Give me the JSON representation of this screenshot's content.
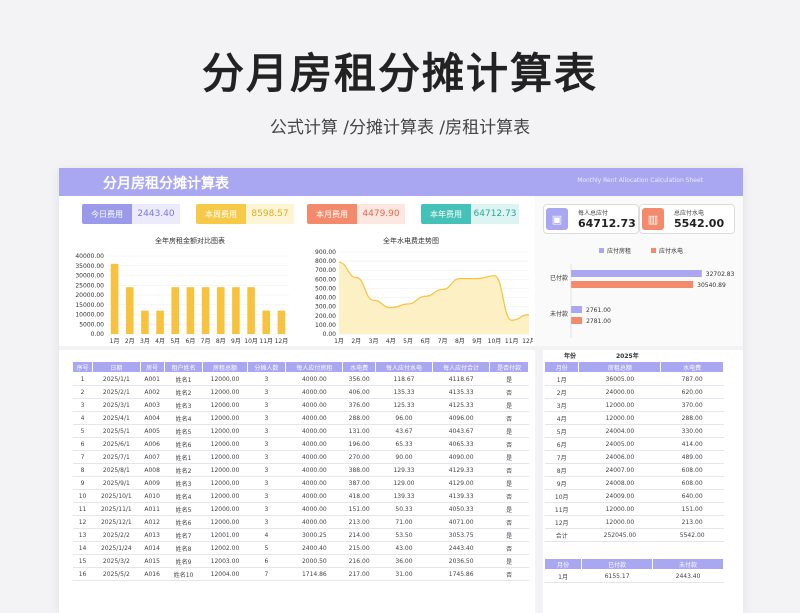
{
  "page": {
    "title": "分月房租分摊计算表",
    "subtitle": "公式计算 /分摊计算表 /房租计算表"
  },
  "sheet": {
    "banner_title": "分月房租分摊计算表",
    "banner_en": "Monthly Rent Allocation Calculation Sheet",
    "stats": [
      {
        "label": "今日费用",
        "value": "2443.40",
        "color": "#9b99ea",
        "bg": "#ecebfb",
        "fg": "#7b79d8"
      },
      {
        "label": "本周费用",
        "value": "8598.57",
        "color": "#f7c948",
        "bg": "#fdf5d6",
        "fg": "#e0ad1d"
      },
      {
        "label": "本月费用",
        "value": "4479.90",
        "color": "#f38a6c",
        "bg": "#fde8e1",
        "fg": "#e2694a"
      },
      {
        "label": "本年费用",
        "value": "64712.73",
        "color": "#45c2b8",
        "bg": "#dcf4f2",
        "fg": "#2fa69c"
      }
    ],
    "kpi": [
      {
        "title": "每人总应付",
        "value": "64712.73",
        "color": "#a9a6f2"
      },
      {
        "title": "总应付水电",
        "value": "5542.00",
        "color": "#f38a6c"
      }
    ],
    "legend": {
      "a": "应付房租",
      "b": "应付水电"
    },
    "hbar_categories": [
      "已付款",
      "未付款"
    ],
    "hbar_values": {
      "rent": [
        32702.83,
        2761.0
      ],
      "util": [
        30540.89,
        2781.0
      ]
    },
    "hbar_labels": {
      "rent": [
        "32702.83",
        "2761.00"
      ],
      "util": [
        "30540.89",
        "2781.00"
      ]
    }
  },
  "chart_data": [
    {
      "type": "bar",
      "title": "全年房租金额对比图表",
      "categories": [
        "1月",
        "2月",
        "3月",
        "4月",
        "5月",
        "6月",
        "7月",
        "8月",
        "9月",
        "10月",
        "11月",
        "12月"
      ],
      "values": [
        36005,
        24000,
        12000,
        12000,
        24004,
        24005,
        24006,
        24007,
        24008,
        24009,
        12000,
        12000
      ],
      "ylim": [
        0,
        40000
      ],
      "yticks": [
        "40000.00",
        "35000.00",
        "30000.00",
        "25000.00",
        "20000.00",
        "15000.00",
        "10000.00",
        "5000.00",
        "0.00"
      ],
      "color": "#f7c23d"
    },
    {
      "type": "area",
      "title": "全年水电费走势图",
      "categories": [
        "1月",
        "2月",
        "3月",
        "4月",
        "5月",
        "6月",
        "7月",
        "8月",
        "9月",
        "10月",
        "11月",
        "12月"
      ],
      "values": [
        787,
        620,
        370,
        288,
        330,
        414,
        489,
        608,
        608,
        640,
        151,
        213
      ],
      "ylim": [
        0,
        900
      ],
      "yticks": [
        "900.00",
        "800.00",
        "700.00",
        "600.00",
        "500.00",
        "400.00",
        "300.00",
        "200.00",
        "100.00",
        "0.00"
      ],
      "color": "#f7c23d"
    }
  ],
  "main_table": {
    "headers": [
      "序号",
      "日期",
      "房号",
      "租户姓名",
      "房租总额",
      "分摊人数",
      "每人应付房租",
      "水电费",
      "每人应付水电",
      "每人应付合计",
      "是否付款"
    ],
    "rows": [
      [
        "1",
        "2025/1/1",
        "A001",
        "姓名1",
        "12000.00",
        "3",
        "4000.00",
        "356.00",
        "118.67",
        "4118.67",
        "是"
      ],
      [
        "2",
        "2025/2/1",
        "A002",
        "姓名2",
        "12000.00",
        "3",
        "4000.00",
        "406.00",
        "135.33",
        "4135.33",
        "否"
      ],
      [
        "3",
        "2025/3/1",
        "A003",
        "姓名3",
        "12000.00",
        "3",
        "4000.00",
        "376.00",
        "125.33",
        "4125.33",
        "是"
      ],
      [
        "4",
        "2025/4/1",
        "A004",
        "姓名4",
        "12000.00",
        "3",
        "4000.00",
        "288.00",
        "96.00",
        "4096.00",
        "否"
      ],
      [
        "5",
        "2025/5/1",
        "A005",
        "姓名5",
        "12000.00",
        "3",
        "4000.00",
        "131.00",
        "43.67",
        "4043.67",
        "是"
      ],
      [
        "6",
        "2025/6/1",
        "A006",
        "姓名6",
        "12000.00",
        "3",
        "4000.00",
        "196.00",
        "65.33",
        "4065.33",
        "否"
      ],
      [
        "7",
        "2025/7/1",
        "A007",
        "姓名1",
        "12000.00",
        "3",
        "4000.00",
        "270.00",
        "90.00",
        "4090.00",
        "是"
      ],
      [
        "8",
        "2025/8/1",
        "A008",
        "姓名2",
        "12000.00",
        "3",
        "4000.00",
        "388.00",
        "129.33",
        "4129.33",
        "否"
      ],
      [
        "9",
        "2025/9/1",
        "A009",
        "姓名3",
        "12000.00",
        "3",
        "4000.00",
        "387.00",
        "129.00",
        "4129.00",
        "是"
      ],
      [
        "10",
        "2025/10/1",
        "A010",
        "姓名4",
        "12000.00",
        "3",
        "4000.00",
        "418.00",
        "139.33",
        "4139.33",
        "否"
      ],
      [
        "11",
        "2025/11/1",
        "A011",
        "姓名5",
        "12000.00",
        "3",
        "4000.00",
        "151.00",
        "50.33",
        "4050.33",
        "是"
      ],
      [
        "12",
        "2025/12/1",
        "A012",
        "姓名6",
        "12000.00",
        "3",
        "4000.00",
        "213.00",
        "71.00",
        "4071.00",
        "否"
      ],
      [
        "13",
        "2025/2/2",
        "A013",
        "姓名7",
        "12001.00",
        "4",
        "3000.25",
        "214.00",
        "53.50",
        "3053.75",
        "是"
      ],
      [
        "14",
        "2025/1/24",
        "A014",
        "姓名8",
        "12002.00",
        "5",
        "2400.40",
        "215.00",
        "43.00",
        "2443.40",
        "否"
      ],
      [
        "15",
        "2025/3/2",
        "A015",
        "姓名9",
        "12003.00",
        "6",
        "2000.50",
        "216.00",
        "36.00",
        "2036.50",
        "是"
      ],
      [
        "16",
        "2025/5/2",
        "A016",
        "姓名10",
        "12004.00",
        "7",
        "1714.86",
        "217.00",
        "31.00",
        "1745.86",
        "否"
      ]
    ]
  },
  "month_table": {
    "year_label": "年份",
    "year_value": "2025年",
    "headers": [
      "月份",
      "房租总额",
      "水电费"
    ],
    "rows": [
      [
        "1月",
        "36005.00",
        "787.00"
      ],
      [
        "2月",
        "24000.00",
        "620.00"
      ],
      [
        "3月",
        "12000.00",
        "370.00"
      ],
      [
        "4月",
        "12000.00",
        "288.00"
      ],
      [
        "5月",
        "24004.00",
        "330.00"
      ],
      [
        "6月",
        "24005.00",
        "414.00"
      ],
      [
        "7月",
        "24006.00",
        "489.00"
      ],
      [
        "8月",
        "24007.00",
        "608.00"
      ],
      [
        "9月",
        "24008.00",
        "608.00"
      ],
      [
        "10月",
        "24009.00",
        "640.00"
      ],
      [
        "11月",
        "12000.00",
        "151.00"
      ],
      [
        "12月",
        "12000.00",
        "213.00"
      ],
      [
        "合计",
        "252045.00",
        "5542.00"
      ]
    ]
  },
  "pay_table": {
    "headers": [
      "月份",
      "已付款",
      "未付款"
    ],
    "rows": [
      [
        "1月",
        "6155.17",
        "2443.40"
      ]
    ]
  }
}
